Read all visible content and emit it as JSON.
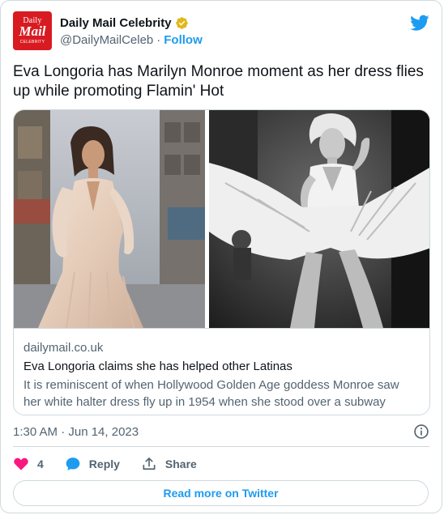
{
  "author": {
    "display_name": "Daily Mail Celebrity",
    "handle": "@DailyMailCeleb",
    "separator": "·",
    "follow_label": "Follow",
    "avatar": {
      "line1": "Daily",
      "line2": "Mail",
      "line3": "CELEBRITY"
    },
    "verified_icon": "gold-verified-badge-icon",
    "platform_icon": "twitter-bird-icon"
  },
  "tweet": {
    "text": "Eva Longoria has Marilyn Monroe moment as her dress flies up while promoting Flamin' Hot"
  },
  "link_card": {
    "domain": "dailymail.co.uk",
    "title": "Eva Longoria claims she has helped other Latinas",
    "description": "It is reminiscent of when Hollywood Golden Age goddess Monroe saw her white halter dress fly up in 1954 when she stood over a subway grat..."
  },
  "meta": {
    "timestamp": "1:30 AM · Jun 14, 2023",
    "info_icon": "info-circle-icon"
  },
  "actions": {
    "like_count": "4",
    "reply_label": "Reply",
    "share_label": "Share"
  },
  "footer": {
    "read_more_label": "Read more on Twitter"
  },
  "colors": {
    "brand_blue": "#1d9bf0",
    "like_pink": "#f91880",
    "daily_mail_red": "#d81b21",
    "gold_badge": "#e2b719",
    "secondary_text": "#536471",
    "border": "#cfd9de"
  }
}
